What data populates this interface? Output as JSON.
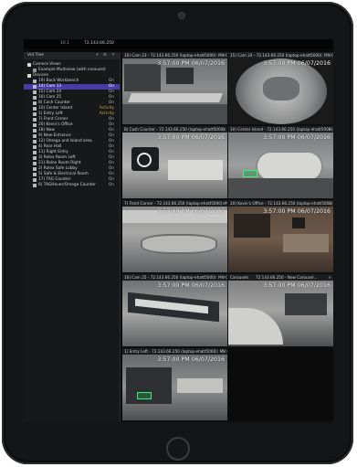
{
  "window": {
    "app_label": "10.1",
    "ip": "72.143.66.250"
  },
  "sidebar": {
    "title": "Vid Tree",
    "controls": "▾ ⊞ ✕",
    "items": [
      {
        "label": "Camera Views",
        "status": "",
        "kind": "folder",
        "indent": 0
      },
      {
        "label": "Example Multiview (with carousel)",
        "status": "",
        "kind": "view",
        "indent": 1
      },
      {
        "label": "Devices",
        "status": "",
        "kind": "folder",
        "indent": 0
      },
      {
        "label": "19) Back Workbench",
        "status": "On",
        "kind": "cam",
        "indent": 1
      },
      {
        "label": "14) Cam 13",
        "status": "On",
        "kind": "cam",
        "indent": 1,
        "selected": true
      },
      {
        "label": "15) Cam 24",
        "status": "On",
        "kind": "cam",
        "indent": 1
      },
      {
        "label": "16) Cam 25",
        "status": "On",
        "kind": "cam",
        "indent": 1
      },
      {
        "label": "8) Cash Counter",
        "status": "On",
        "kind": "cam",
        "indent": 1
      },
      {
        "label": "10) Center Island",
        "status": "Activity",
        "kind": "cam",
        "indent": 1
      },
      {
        "label": "1) Entry Left",
        "status": "Activity",
        "kind": "cam",
        "indent": 1
      },
      {
        "label": "7) Front Corner",
        "status": "On",
        "kind": "cam",
        "indent": 1
      },
      {
        "label": "20) Kevin's Office",
        "status": "On",
        "kind": "cam",
        "indent": 1
      },
      {
        "label": "18) New",
        "status": "On",
        "kind": "cam",
        "indent": 1
      },
      {
        "label": "9) New Entrance",
        "status": "On",
        "kind": "cam",
        "indent": 1
      },
      {
        "label": "12) Omega and Island area",
        "status": "On",
        "kind": "cam",
        "indent": 1
      },
      {
        "label": "4) Rear Hall",
        "status": "On",
        "kind": "cam",
        "indent": 1
      },
      {
        "label": "11) Right Entry",
        "status": "On",
        "kind": "cam",
        "indent": 1
      },
      {
        "label": "3) Rolex Room Left",
        "status": "On",
        "kind": "cam",
        "indent": 1
      },
      {
        "label": "21) Rolex Room Right",
        "status": "On",
        "kind": "cam",
        "indent": 1
      },
      {
        "label": "2) Rolex Safe Lobby",
        "status": "On",
        "kind": "cam",
        "indent": 1
      },
      {
        "label": "5) Safe & Electrical Room",
        "status": "On",
        "kind": "cam",
        "indent": 1
      },
      {
        "label": "17) TAG Counter",
        "status": "On",
        "kind": "cam",
        "indent": 1
      },
      {
        "label": "6) TAGHeuer/Omega Counter",
        "status": "On",
        "kind": "cam",
        "indent": 1
      }
    ]
  },
  "tiles": [
    {
      "title": "16) Cam 23 - 72.143.66.250 (laptop-ehatt5000): MV Cons...",
      "timestamp": "3:57:00 PM 06/07/2016",
      "scene": "store-wide",
      "badge": false
    },
    {
      "title": "15) Cam 24 - 72.143.66.250 (laptop-ehatt5000): MV Cons...",
      "timestamp": "3:57:00 PM 06/07/2016",
      "scene": "fisheye",
      "badge": false
    },
    {
      "title": "8) Cash Counter - 72.143.66.250 (laptop-ehatt5000): M...",
      "timestamp": "3:57:00 PM 06/07/2016",
      "scene": "counter",
      "badge": false
    },
    {
      "title": "10) Center Island - 72.143.66.250 (laptop-ehatt5000): ...",
      "timestamp": "3:57:00 PM 06/07/2016",
      "scene": "island",
      "badge": true
    },
    {
      "title": "7) Front Corner - 72.143.66.250 (laptop-ehatt5000): MV...",
      "timestamp": "3:57:00 PM 06/07/2016",
      "scene": "corner",
      "badge": false
    },
    {
      "title": "20) Kevin's Office - 72.143.66.250 (laptop-ehatt5000):...",
      "timestamp": "3:57:00 PM 06/07/2016",
      "scene": "office",
      "badge": false
    },
    {
      "title": "16) Cam 25 - 72.143.66.250 (laptop-ehatt5000): MV Cons...",
      "timestamp": "3:57:00 PM 06/07/2016",
      "scene": "cases",
      "badge": false
    },
    {
      "title": "Carousels",
      "title2": "72.143.66.250 - New Carousel...",
      "timestamp": "3:57:00 PM 06/07/2016",
      "scene": "carousel",
      "badge": false
    },
    {
      "title": "1) Entry Left - 72.143.66.250 (laptop-ehatt5000): MV Co...",
      "timestamp": "3:57:00 PM 06/07/2016",
      "scene": "entry",
      "badge": true
    }
  ]
}
